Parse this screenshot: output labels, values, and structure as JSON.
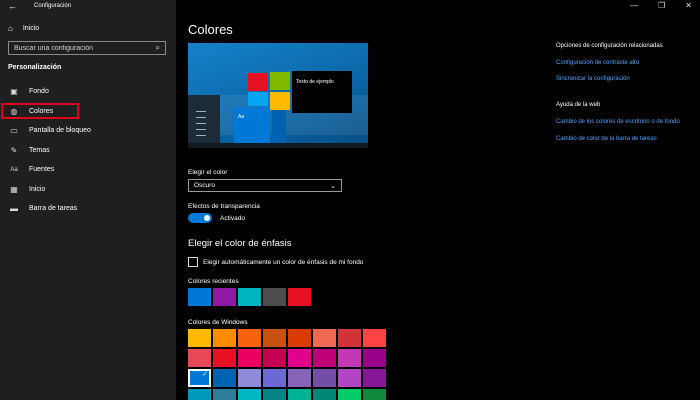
{
  "window": {
    "title": "Configuración",
    "back_glyph": "←",
    "minimize_glyph": "—",
    "maximize_glyph": "❐",
    "close_glyph": "✕"
  },
  "sidebar": {
    "home_label": "Inicio",
    "search_placeholder": "Buscar una configuración",
    "section_title": "Personalización",
    "items": [
      {
        "label": "Fondo",
        "icon": "picture-icon",
        "glyph": "▣"
      },
      {
        "label": "Colores",
        "icon": "palette-icon",
        "glyph": "◍",
        "active": true
      },
      {
        "label": "Pantalla de bloqueo",
        "icon": "lock-screen-icon",
        "glyph": "▭"
      },
      {
        "label": "Temas",
        "icon": "brush-icon",
        "glyph": "✎"
      },
      {
        "label": "Fuentes",
        "icon": "fonts-icon",
        "glyph": "Aa"
      },
      {
        "label": "Inicio",
        "icon": "start-icon",
        "glyph": "▦"
      },
      {
        "label": "Barra de tareas",
        "icon": "taskbar-icon",
        "glyph": "▬"
      }
    ]
  },
  "main": {
    "title": "Colores",
    "preview": {
      "sample_text": "Texto de ejemplo",
      "tile_text": "Aa"
    },
    "choose_color_label": "Elegir el color",
    "choose_color_value": "Oscuro",
    "transparency_label": "Efectos de transparencia",
    "transparency_value": "Activado",
    "accent_heading": "Elegir el color de énfasis",
    "auto_accent_label": "Elegir automáticamente un color de énfasis de mi fondo",
    "recent_colors_label": "Colores recientes",
    "recent_colors": [
      "#0078d7",
      "#8e1aa3",
      "#00b4c0",
      "#4c4c4c",
      "#e81123"
    ],
    "windows_colors_label": "Colores de Windows",
    "windows_colors": [
      "#ffb900",
      "#ff8c00",
      "#f7630c",
      "#ca5010",
      "#da3b01",
      "#ef6950",
      "#d13438",
      "#ff4343",
      "#e74856",
      "#e81123",
      "#ea005e",
      "#c30052",
      "#e3008c",
      "#bf0077",
      "#c239b3",
      "#9a0089",
      "#0078d7",
      "#0063b1",
      "#8e8cd8",
      "#6b69d6",
      "#8764b8",
      "#744da9",
      "#b146c2",
      "#881798",
      "#0099bc",
      "#2d7d9a",
      "#00b7c3",
      "#038387",
      "#00b294",
      "#018574",
      "#00cc6a",
      "#10893e"
    ],
    "selected_color_index": 16
  },
  "right_panel": {
    "related_title": "Opciones de configuración relacionadas",
    "links": [
      "Configuración de contraste alto",
      "Sincronizar la configuración"
    ],
    "help_title": "Ayuda de la web",
    "help_links": [
      "Cambio de los colores de escritorio o de fondo",
      "Cambio de color de la barra de tareas"
    ]
  },
  "colors": {
    "accent": "#0078d7",
    "sidebar_bg": "#1f1f1f",
    "main_bg": "#000000",
    "highlight_border": "#e0001b",
    "link": "#4aa3ff"
  }
}
